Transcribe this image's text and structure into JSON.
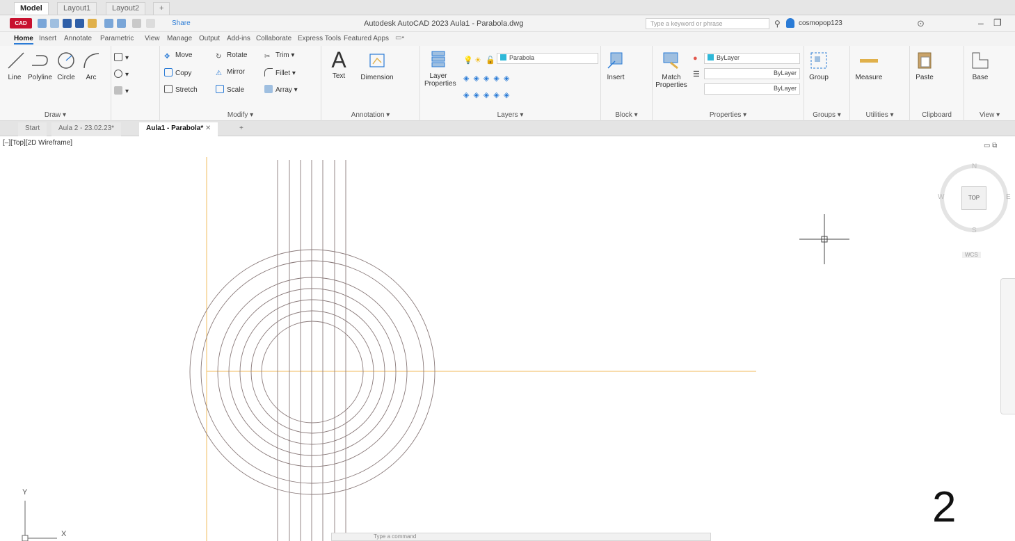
{
  "layout_tabs": [
    "Model",
    "Layout1",
    "Layout2",
    "+"
  ],
  "app": {
    "logo": "CAD",
    "title": "Autodesk AutoCAD 2023   Aula1 - Parabola.dwg",
    "share": "Share",
    "search_placeholder": "Type a keyword or phrase",
    "user": "cosmopop123"
  },
  "ribbon_tabs": [
    "Home",
    "Insert",
    "Annotate",
    "Parametric",
    "View",
    "Manage",
    "Output",
    "Add-ins",
    "Collaborate",
    "Express Tools",
    "Featured Apps"
  ],
  "panels": {
    "draw": {
      "title": "Draw ▾",
      "line": "Line",
      "polyline": "Polyline",
      "circle": "Circle",
      "arc": "Arc"
    },
    "modify": {
      "title": "Modify ▾",
      "move": "Move",
      "rotate": "Rotate",
      "trim": "Trim",
      "copy": "Copy",
      "mirror": "Mirror",
      "fillet": "Fillet",
      "stretch": "Stretch",
      "scale": "Scale",
      "array": "Array"
    },
    "annotation": {
      "title": "Annotation ▾",
      "text": "Text",
      "dimension": "Dimension"
    },
    "layers": {
      "title": "Layers ▾",
      "layer_properties_1": "Layer",
      "layer_properties_2": "Properties",
      "current_layer": "Parabola"
    },
    "block": {
      "title": "Block ▾",
      "insert": "Insert"
    },
    "properties": {
      "title": "Properties ▾",
      "match_1": "Match",
      "match_2": "Properties",
      "color": "ByLayer",
      "linetype": "ByLayer",
      "lineweight": "ByLayer"
    },
    "groups": {
      "title": "Groups ▾",
      "group": "Group"
    },
    "utilities": {
      "title": "Utilities ▾",
      "measure": "Measure"
    },
    "clipboard": {
      "title": "Clipboard",
      "paste": "Paste"
    },
    "view": {
      "title": "View ▾",
      "base": "Base"
    }
  },
  "file_tabs": [
    "Start",
    "Aula 2 - 23.02.23*",
    "Aula1 - Parabola*",
    "+"
  ],
  "viewport": {
    "label": "[–][Top][2D Wireframe]",
    "viewcube": {
      "top": "TOP",
      "north": "N",
      "south": "S",
      "east": "E",
      "west": "W",
      "wcs": "WCS"
    },
    "ucs_x": "X",
    "ucs_y": "Y",
    "overlay_number": "2",
    "command_placeholder": "Type a command"
  },
  "colors": {
    "axis_line": "#f3c77a",
    "geometry": "#8a7a7a",
    "accent": "#2a7bd6",
    "logo": "#c8102e"
  }
}
